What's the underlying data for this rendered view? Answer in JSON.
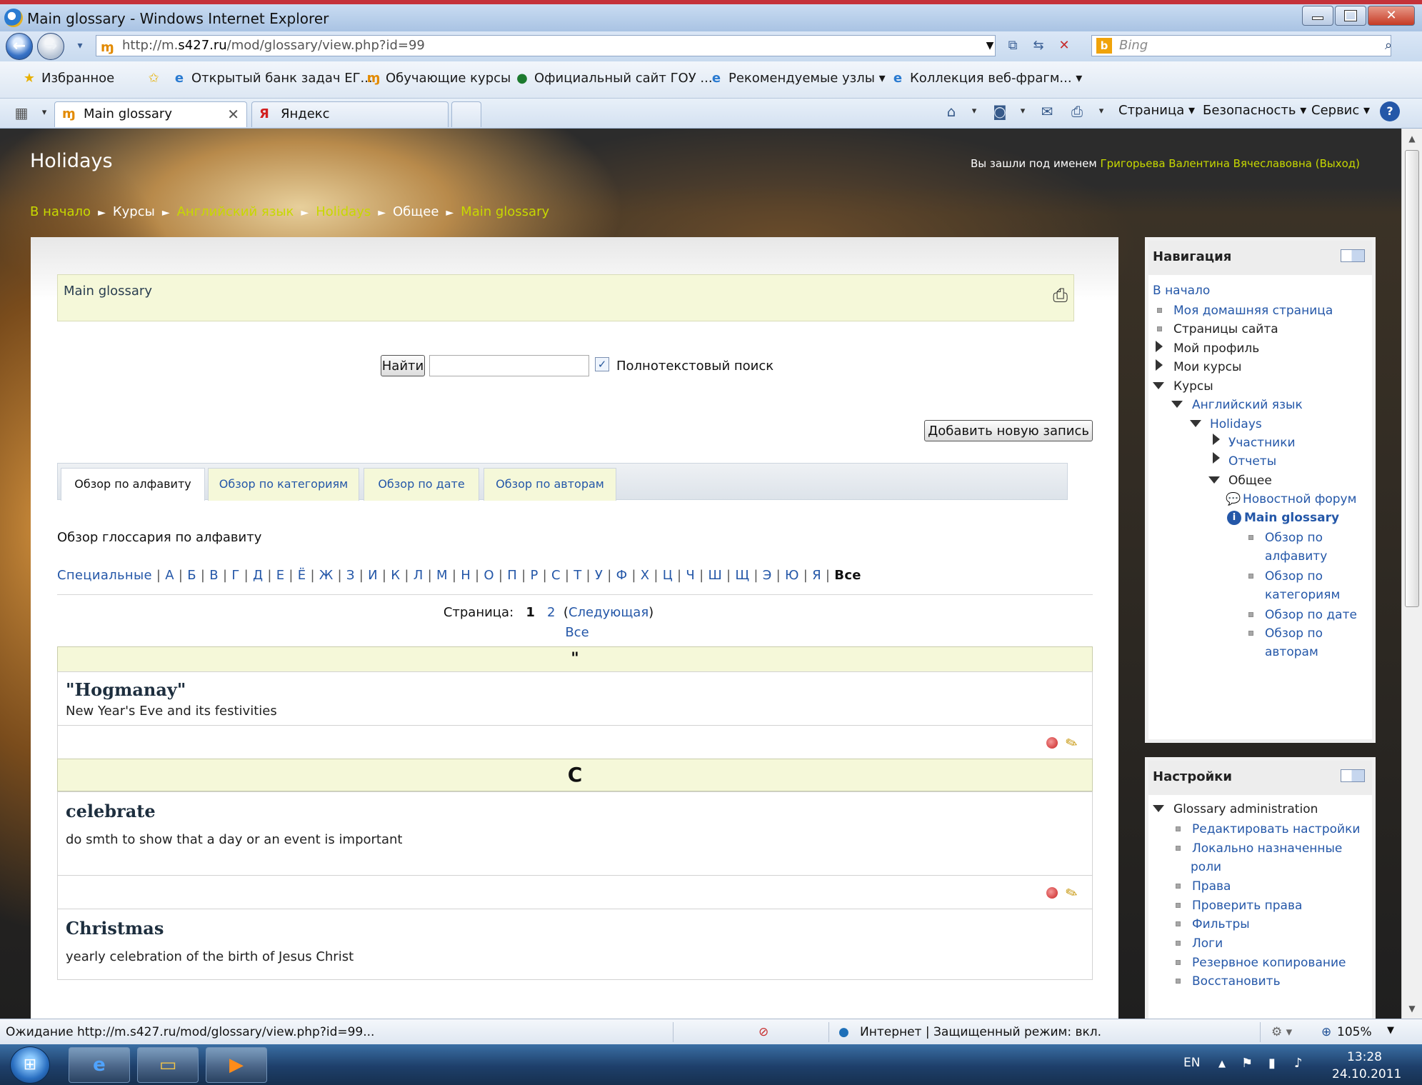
{
  "window": {
    "title": "Main glossary - Windows Internet Explorer",
    "minimize": "‒",
    "maximize": "▢",
    "close": "✕"
  },
  "address": {
    "url_prefix": "http://m.",
    "url_host": "s427.ru",
    "url_path": "/mod/glossary/view.php?id=99",
    "search_engine": "Bing",
    "search_placeholder": "Bing"
  },
  "favorites_bar": {
    "favorites_label": "Избранное",
    "links": [
      "Открытый банк задач ЕГ...",
      "Обучающие курсы",
      "Официальный сайт ГОУ ...",
      "Рекомендуемые узлы ▾",
      "Коллекция веб-фрагм... ▾"
    ]
  },
  "tabs": {
    "active_tab": "Main glossary",
    "second_tab": "Яндекс",
    "close_glyph": "✕"
  },
  "toolbar": {
    "page_menu": "Страница ▾",
    "security_menu": "Безопасность ▾",
    "tools_menu": "Сервис ▾",
    "help": "?"
  },
  "page": {
    "course_title": "Holidays",
    "login_prefix": "Вы зашли под именем ",
    "user_name": "Григорьева Валентина Вячеславовна",
    "logout": "(Выход)",
    "breadcrumb": {
      "home": "В начало",
      "courses": "Курсы",
      "subject": "Английский язык",
      "course": "Holidays",
      "section": "Общее",
      "current": "Main glossary",
      "separator": "►"
    },
    "glossary_name": "Main glossary",
    "search": {
      "button": "Найти",
      "value": "",
      "fulltext_checked": "✓",
      "fulltext_label": "Полнотекстовый поиск"
    },
    "add_entry_button": "Добавить новую запись",
    "view_tabs": [
      "Обзор по алфавиту",
      "Обзор по категориям",
      "Обзор по дате",
      "Обзор по авторам"
    ],
    "alpha_heading": "Обзор глоссария по алфавиту",
    "letters": {
      "special": "Специальные",
      "list": [
        "А",
        "Б",
        "В",
        "Г",
        "Д",
        "Е",
        "Ё",
        "Ж",
        "З",
        "И",
        "К",
        "Л",
        "М",
        "Н",
        "О",
        "П",
        "Р",
        "С",
        "Т",
        "У",
        "Ф",
        "Х",
        "Ц",
        "Ч",
        "Ш",
        "Щ",
        "Э",
        "Ю",
        "Я"
      ],
      "all": "Все",
      "separator": "|"
    },
    "pager": {
      "label": "Страница:",
      "current": "1",
      "next_page": "2",
      "next_label": "Следующая",
      "all": "Все"
    },
    "sections": [
      {
        "letter": "\""
      },
      {
        "letter": "C"
      }
    ],
    "entries": [
      {
        "term": "\"Hogmanay\"",
        "definition": "New Year's Eve and its festivities"
      },
      {
        "term": "celebrate",
        "definition": "do smth to show that a day or an event is important"
      },
      {
        "term": "Christmas",
        "definition": "yearly celebration of the birth of Jesus Christ"
      }
    ]
  },
  "navigation_block": {
    "title": "Навигация",
    "home": "В начало",
    "my_home": "Моя домашняя страница",
    "site_pages": "Страницы сайта",
    "my_profile": "Мой профиль",
    "my_courses": "Мои курсы",
    "courses": "Курсы",
    "subject": "Английский язык",
    "course": "Holidays",
    "participants": "Участники",
    "reports": "Отчеты",
    "general": "Общее",
    "news_forum": "Новостной форум",
    "glossary": "Main glossary",
    "browse": [
      [
        "Обзор по",
        "алфавиту"
      ],
      [
        "Обзор по",
        "категориям"
      ],
      [
        "Обзор по дате"
      ],
      [
        "Обзор по",
        "авторам"
      ]
    ]
  },
  "settings_block": {
    "title": "Настройки",
    "admin": "Glossary administration",
    "items": [
      "Редактировать настройки",
      "Локально назначенные",
      "роли",
      "Права",
      "Проверить права",
      "Фильтры",
      "Логи",
      "Резервное копирование",
      "Восстановить"
    ]
  },
  "statusbar": {
    "loading": "Ожидание http://m.s427.ru/mod/glossary/view.php?id=99...",
    "zone": "Интернет | Защищенный режим: вкл.",
    "zoom": "105%"
  },
  "taskbar": {
    "lang": "EN",
    "time": "13:28",
    "date": "24.10.2011"
  },
  "colors": {
    "link": "#2457a8",
    "breadcrumb_link": "#c7d800",
    "band": "#f5f8d9"
  }
}
